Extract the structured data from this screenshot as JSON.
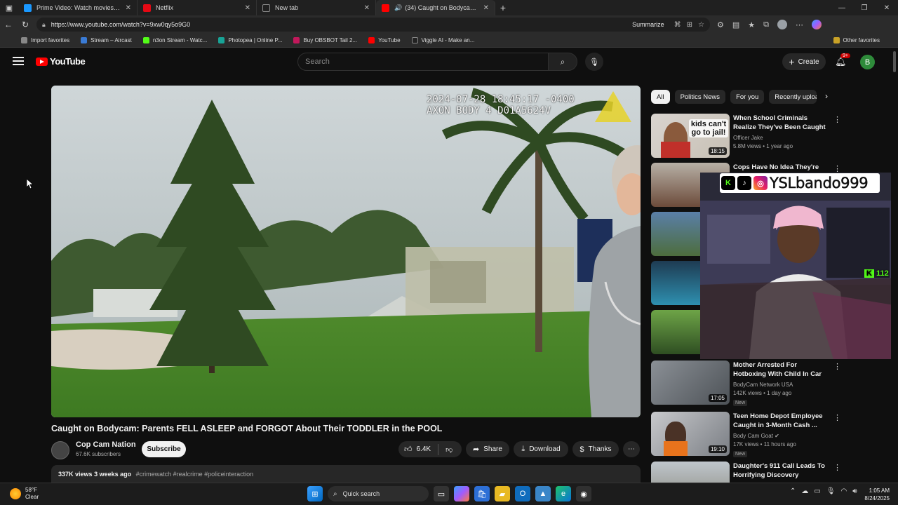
{
  "browser": {
    "tabs": [
      {
        "label": "Prime Video: Watch movies, TV sh",
        "color": "#1a98ff"
      },
      {
        "label": "Netflix",
        "color": "#e50914"
      },
      {
        "label": "New tab",
        "color": "#666666"
      },
      {
        "label": "(34) Caught on Bodycam: Pa",
        "color": "#ff0000",
        "active": true
      }
    ],
    "url": "https://www.youtube.com/watch?v=9xw0qy5o9G0",
    "summarize": "Summarize",
    "favorites": [
      {
        "label": "Import favorites",
        "color": "#888888"
      },
      {
        "label": "Stream – Aircast",
        "color": "#3a7bd5"
      },
      {
        "label": "n3on Stream - Watc...",
        "color": "#53fc18"
      },
      {
        "label": "Photopea | Online P...",
        "color": "#18a497"
      },
      {
        "label": "Buy OBSBOT Tail 2...",
        "color": "#c2185b"
      },
      {
        "label": "YouTube",
        "color": "#ff0000"
      },
      {
        "label": "Viggle AI - Make an...",
        "color": "#222222"
      }
    ],
    "other_favorites": "Other favorites"
  },
  "yt": {
    "logo": "YouTube",
    "search_placeholder": "Search",
    "create": "Create",
    "notif_count": "9+",
    "avatar_letter": "B"
  },
  "video": {
    "overlay_line1": "2024-07-28 18:45:17 -0400",
    "overlay_line2": "AXON BODY 4 D01A5624V",
    "title": "Caught on Bodycam: Parents FELL ASLEEP and FORGOT About Their TODDLER in the POOL",
    "channel": "Cop Cam Nation",
    "subscribers": "67.6K subscribers",
    "subscribe": "Subscribe",
    "likes": "6.4K",
    "share": "Share",
    "download": "Download",
    "thanks": "Thanks",
    "views": "337K views",
    "age": "3 weeks ago",
    "tags": "#crimewatch #realcrime #policeinteraction"
  },
  "chips": [
    "All",
    "Politics News",
    "For you",
    "Recently uploa"
  ],
  "recommendations": [
    {
      "title": "When School Criminals Realize They've Been Caught",
      "channel": "Officer Jake",
      "meta": "5.8M views • 1 year ago",
      "duration": "18:15",
      "thumb_text": "kids can't go to jail!"
    },
    {
      "title": "Cops Have No Idea They're",
      "channel": "",
      "meta": "",
      "duration": ""
    },
    {
      "title": "",
      "channel": "",
      "meta": "",
      "duration": ""
    },
    {
      "title": "",
      "channel": "",
      "meta": "",
      "duration": ""
    },
    {
      "title": "",
      "channel": "",
      "meta": "",
      "duration": ""
    },
    {
      "title": "Mother Arrested For Hotboxing With Child In Car",
      "channel": "BodyCam Network USA",
      "meta": "142K views • 1 day ago",
      "duration": "17:05",
      "badge": "New"
    },
    {
      "title": "Teen Home Depot Employee Caught in 3-Month Cash ...",
      "channel": "Body Cam Goat ✔",
      "meta": "17K views • 11 hours ago",
      "duration": "19:10",
      "badge": "New"
    },
    {
      "title": "Daughter's 911 Call Leads To Horrifying Discovery",
      "channel": "",
      "meta": "",
      "duration": ""
    }
  ],
  "stream": {
    "name": "YSLbando999",
    "kick_count": "112"
  },
  "taskbar": {
    "temp": "58°F",
    "condition": "Clear",
    "search": "Quick search",
    "time": "1:05 AM",
    "date": "8/24/2025"
  }
}
